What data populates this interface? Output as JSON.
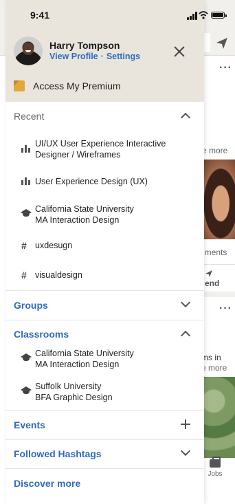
{
  "status_bar": {
    "time": "9:41"
  },
  "background_feed": {
    "see_more_1": "e more",
    "comments": "nments",
    "send_label": "end",
    "ms_in": "ms in",
    "see_more_2": "e more",
    "jobs_label": "Jobs"
  },
  "profile": {
    "name": "Harry Tompson",
    "view_profile": "View Profile",
    "separator": "·",
    "settings": "Settings"
  },
  "premium": {
    "label": "Access My Premium"
  },
  "recent": {
    "label": "Recent",
    "items": [
      {
        "icon": "group-icon",
        "line1": "UI/UX User Experience Interactive",
        "line2": "Designer / Wireframes"
      },
      {
        "icon": "group-icon",
        "line1": "User Experience Design (UX)",
        "line2": ""
      },
      {
        "icon": "graduation-cap-icon",
        "line1": "California State University",
        "line2": "MA Interaction Design"
      },
      {
        "icon": "hashtag-icon",
        "line1": "uxdesugn",
        "line2": ""
      },
      {
        "icon": "hashtag-icon",
        "line1": "visualdesign",
        "line2": ""
      }
    ]
  },
  "groups": {
    "label": "Groups"
  },
  "classrooms": {
    "label": "Classrooms",
    "items": [
      {
        "icon": "graduation-cap-icon",
        "line1": "California State University",
        "line2": "MA Interaction Design"
      },
      {
        "icon": "graduation-cap-icon",
        "line1": "Suffolk University",
        "line2": "BFA Graphic Design"
      }
    ]
  },
  "events": {
    "label": "Events"
  },
  "followed_hashtags": {
    "label": "Followed Hashtags"
  },
  "discover_more": {
    "label": "Discover more"
  },
  "colors": {
    "accent": "#2f6bbf",
    "header_bg": "#e9e5dd",
    "premium": "#e0a93b"
  }
}
